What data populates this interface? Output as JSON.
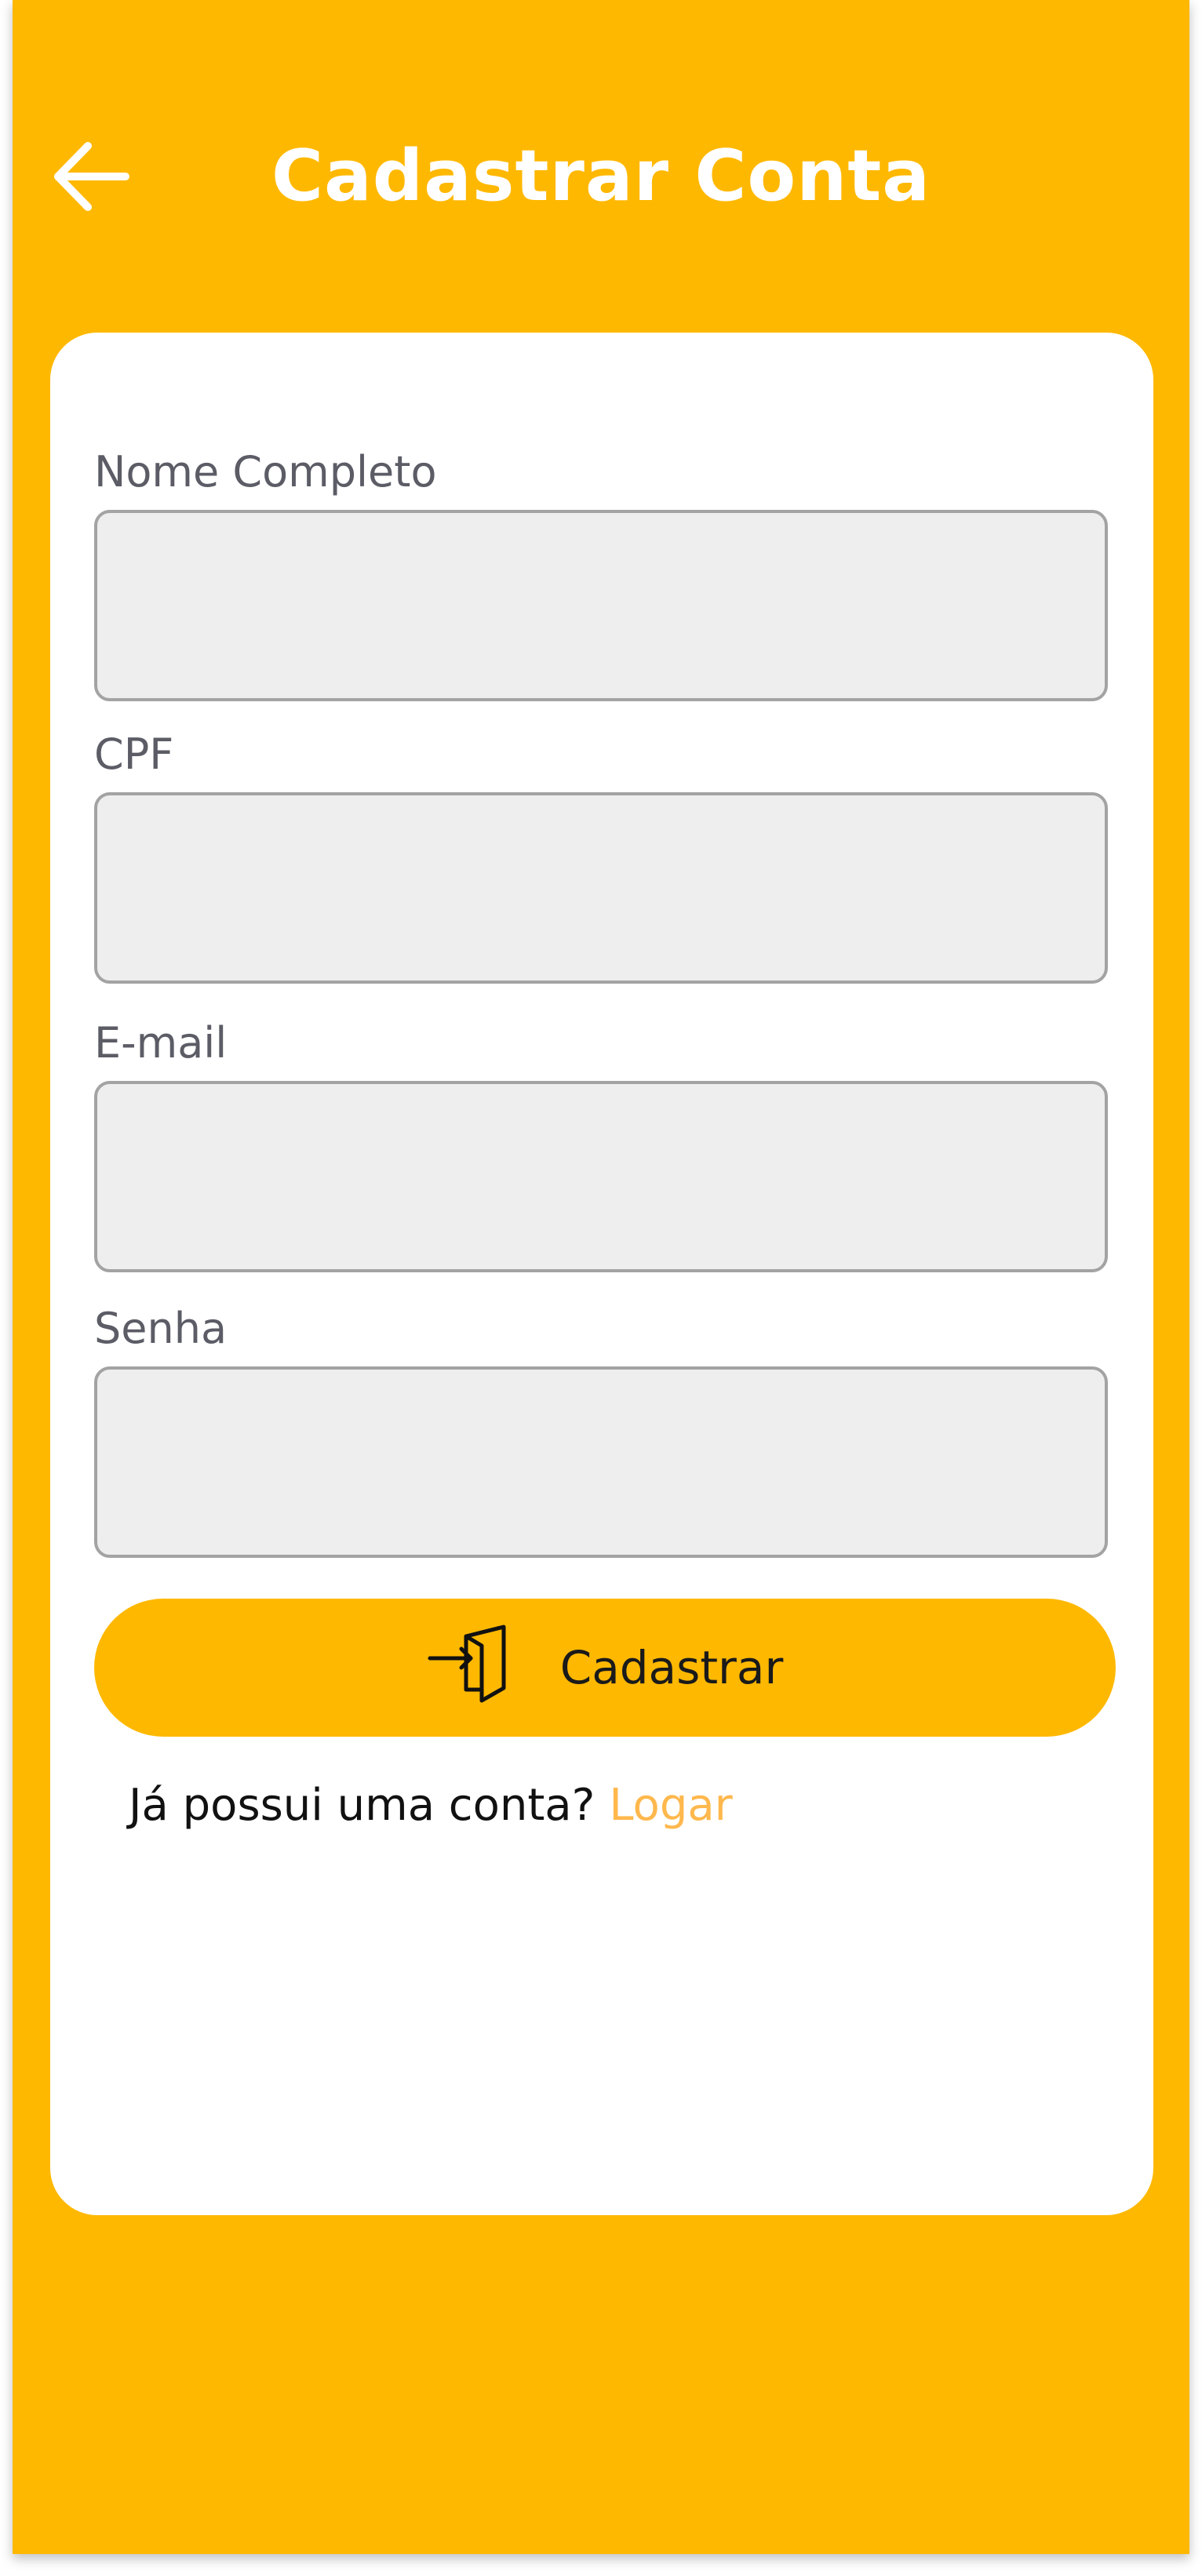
{
  "header": {
    "title": "Cadastrar Conta",
    "back_icon": "arrow-left-icon"
  },
  "form": {
    "fields": [
      {
        "label": "Nome Completo",
        "value": ""
      },
      {
        "label": "CPF",
        "value": ""
      },
      {
        "label": "E-mail",
        "value": ""
      },
      {
        "label": "Senha",
        "value": ""
      }
    ],
    "submit": {
      "label": "Cadastrar",
      "icon": "door-enter-icon"
    },
    "login_prompt": {
      "text": "Já possui uma conta?",
      "link": "Logar"
    }
  },
  "colors": {
    "primary": "#FFB800",
    "link": "#FFB84D",
    "input_bg": "#EEEEEE",
    "input_border": "#A3A3A3",
    "label": "#5c5c66"
  }
}
